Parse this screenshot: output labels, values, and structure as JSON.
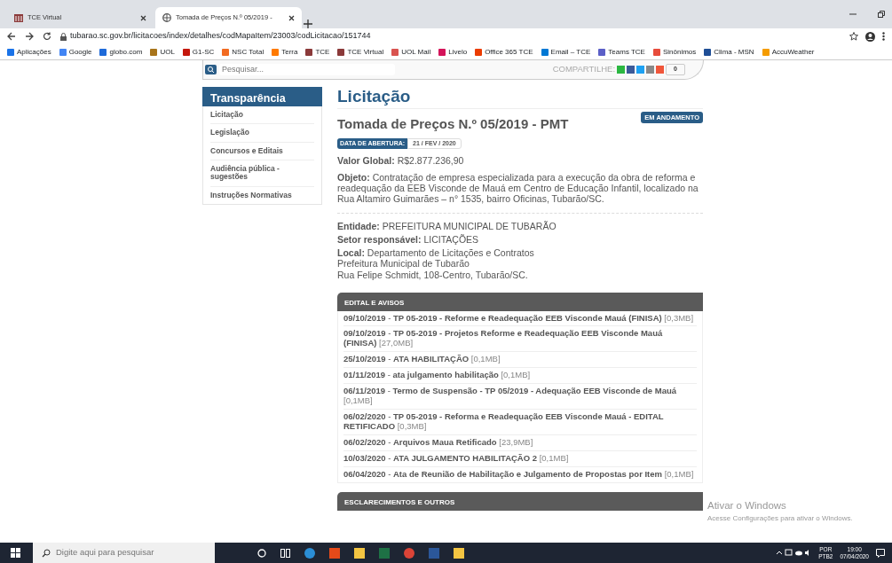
{
  "browser": {
    "tabs": [
      {
        "title": "TCE Virtual",
        "selected": false
      },
      {
        "title": "Tomada de Preços N.º 05/2019 -",
        "selected": true
      }
    ],
    "url": "tubarao.sc.gov.br/licitacoes/index/detalhes/codMapaItem/23003/codLicitacao/151744",
    "bookmarks": [
      {
        "label": "Aplicações",
        "color": "#1a73e8"
      },
      {
        "label": "Google",
        "color": "#4285f4"
      },
      {
        "label": "globo.com",
        "color": "#1e6ad9"
      },
      {
        "label": "UOL",
        "color": "#a8741a"
      },
      {
        "label": "G1-SC",
        "color": "#c4170c"
      },
      {
        "label": "NSC Total",
        "color": "#f26b21"
      },
      {
        "label": "Terra",
        "color": "#ff7a00"
      },
      {
        "label": "TCE",
        "color": "#8b3a3a"
      },
      {
        "label": "TCE Virtual",
        "color": "#8b3a3a"
      },
      {
        "label": "UOL Mail",
        "color": "#d9534f"
      },
      {
        "label": "Livelo",
        "color": "#d4145a"
      },
      {
        "label": "Office 365 TCE",
        "color": "#eb3c00"
      },
      {
        "label": "Email – TCE",
        "color": "#0078d4"
      },
      {
        "label": "Teams TCE",
        "color": "#5b5fc7"
      },
      {
        "label": "Sinônimos",
        "color": "#e74c3c"
      },
      {
        "label": "Clima - MSN",
        "color": "#1f4e96"
      },
      {
        "label": "AccuWeather",
        "color": "#f59c00"
      }
    ]
  },
  "page": {
    "search": {
      "placeholder": "Pesquisar..."
    },
    "share_label": "COMPARTILHE:",
    "share_count": "0",
    "sidebar": {
      "title": "Transparência",
      "items": [
        "Licitação",
        "Legislação",
        "Concursos e Editais",
        "Audiência pública - sugestões",
        "Instruções Normativas"
      ]
    },
    "heading": "Licitação",
    "title": "Tomada de Preços N.º 05/2019 - PMT",
    "status": "EM ANDAMENTO",
    "date_label": "DATA DE ABERTURA:",
    "date_value": "21 / FEV / 2020",
    "fields": [
      {
        "label": "Valor Global:",
        "value": "R$2.877.236,90"
      },
      {
        "label": "Objeto:",
        "value": "Contratação de empresa especializada para a execução da obra de reforma e readequação da EEB Visconde de Mauá em Centro de Educação Infantil, localizado na Rua Altamiro Guimarães – n° 1535, bairro Oficinas, Tubarão/SC."
      }
    ],
    "details": [
      {
        "label": "Entidade:",
        "lines": [
          "PREFEITURA MUNICIPAL DE TUBARÃO"
        ]
      },
      {
        "label": "Setor responsável:",
        "lines": [
          "LICITAÇÕES"
        ]
      },
      {
        "label": "Local:",
        "lines": [
          "Departamento de Licitações e Contratos",
          "Prefeitura Municipal de Tubarão",
          "Rua Felipe Schmidt, 108-Centro, Tubarão/SC."
        ]
      }
    ],
    "sections": [
      {
        "title": "EDITAL E AVISOS",
        "items": [
          {
            "date": "09/10/2019",
            "sep": "-",
            "title": "TP 05-2019 - Reforme e Readequação EEB Visconde Mauá (FINISA)",
            "size": "[0,3MB]"
          },
          {
            "date": "09/10/2019",
            "sep": "-",
            "title": "TP 05-2019 - Projetos Reforme e Readequação EEB Visconde Mauá (FINISA)",
            "size": "[27,0MB]"
          },
          {
            "date": "25/10/2019",
            "sep": "-",
            "title": "ATA HABILITAÇÃO",
            "size": "[0,1MB]"
          },
          {
            "date": "01/11/2019",
            "sep": "-",
            "title": "ata julgamento habilitação",
            "size": "[0,1MB]"
          },
          {
            "date": "06/11/2019",
            "sep": "-",
            "title": "Termo de Suspensão - TP 05/2019 - Adequação EEB Visconde de Mauá",
            "size": "[0,1MB]"
          },
          {
            "date": "06/02/2020",
            "sep": "-",
            "title": "TP 05-2019 - Reforma e Readequação EEB Visconde Mauá - EDITAL RETIFICADO",
            "size": "[0,3MB]"
          },
          {
            "date": "06/02/2020",
            "sep": "-",
            "title": "Arquivos Maua Retificado",
            "size": "[23,9MB]"
          },
          {
            "date": "10/03/2020",
            "sep": "-",
            "title": "ATA JULGAMENTO HABILITAÇÃO 2",
            "size": "[0,1MB]"
          },
          {
            "date": "06/04/2020",
            "sep": "-",
            "title": "Ata de Reunião de Habilitação e Julgamento de Propostas por Item",
            "size": "[0,1MB]"
          }
        ]
      },
      {
        "title": "ESCLARECIMENTOS E OUTROS"
      }
    ]
  },
  "activation": {
    "title": "Ativar o Windows",
    "subtitle": "Acesse Configurações para ativar o Windows."
  },
  "taskbar": {
    "search_placeholder": "Digite aqui para pesquisar",
    "language": "POR",
    "layout": "PTB2",
    "time": "19:00",
    "date": "07/04/2020"
  }
}
